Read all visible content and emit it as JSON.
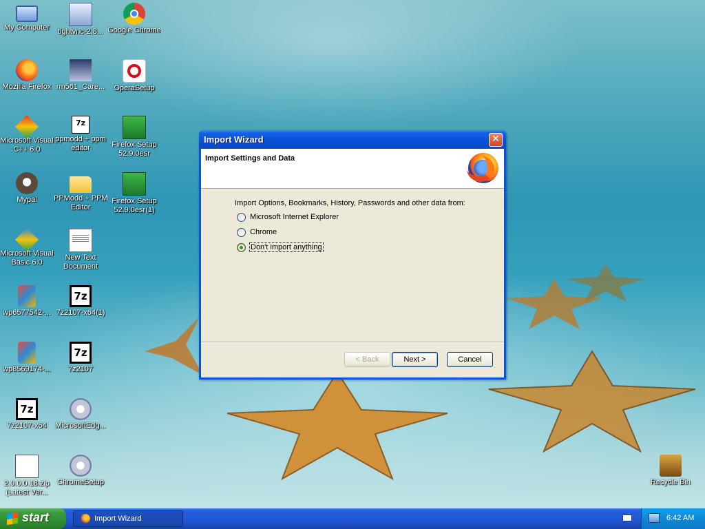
{
  "desktop": {
    "icons": [
      {
        "label": "My Computer"
      },
      {
        "label": "tightvnc-2.8..."
      },
      {
        "label": "Google Chrome"
      },
      {
        "label": "Mozilla Firefox"
      },
      {
        "label": "rm561_Care..."
      },
      {
        "label": "OperaSetup"
      },
      {
        "label": "Microsoft Visual",
        "label2": "C++ 6.0"
      },
      {
        "label": "ppmodd + ppm",
        "label2": "editor"
      },
      {
        "label": "Firefox Setup",
        "label2": "52.9.0esr"
      },
      {
        "label": "Mypal"
      },
      {
        "label": "PPModd + PPM",
        "label2": "Editor"
      },
      {
        "label": "Firefox Setup",
        "label2": "52.9.0esr(1)"
      },
      {
        "label": "Microsoft Visual",
        "label2": "Basic 6.0"
      },
      {
        "label": "New Text",
        "label2": "Document"
      },
      {
        "label": "wp6577542-..."
      },
      {
        "label": "7z2107-x64(1)"
      },
      {
        "label": "wp8569174-..."
      },
      {
        "label": "7z2107"
      },
      {
        "label": "7z2107-x64"
      },
      {
        "label": "MicrosoftEdg..."
      },
      {
        "label": "2.0.0.0.18.zip",
        "label2": "(Latest Ver..."
      },
      {
        "label": "ChromeSetup"
      },
      {
        "label": "Recycle Bin"
      }
    ]
  },
  "dialog": {
    "title": "Import Wizard",
    "close_glyph": "✕",
    "header_title": "Import Settings and Data",
    "prompt": "Import Options, Bookmarks, History, Passwords and other data from:",
    "options": [
      {
        "label": "Microsoft Internet Explorer",
        "checked": false
      },
      {
        "label": "Chrome",
        "checked": false
      },
      {
        "label": "Don't import anything",
        "checked": true
      }
    ],
    "buttons": {
      "back": "< Back",
      "next": "Next >",
      "cancel": "Cancel"
    }
  },
  "taskbar": {
    "start_label": "start",
    "task_item": "Import Wizard",
    "clock": "6:42 AM"
  },
  "colors": {
    "titlebar": "#0a4fd6",
    "dialog_face": "#ece9d8",
    "taskbar": "#245edb",
    "start": "#3c9c3c",
    "tray": "#0e88d8"
  }
}
